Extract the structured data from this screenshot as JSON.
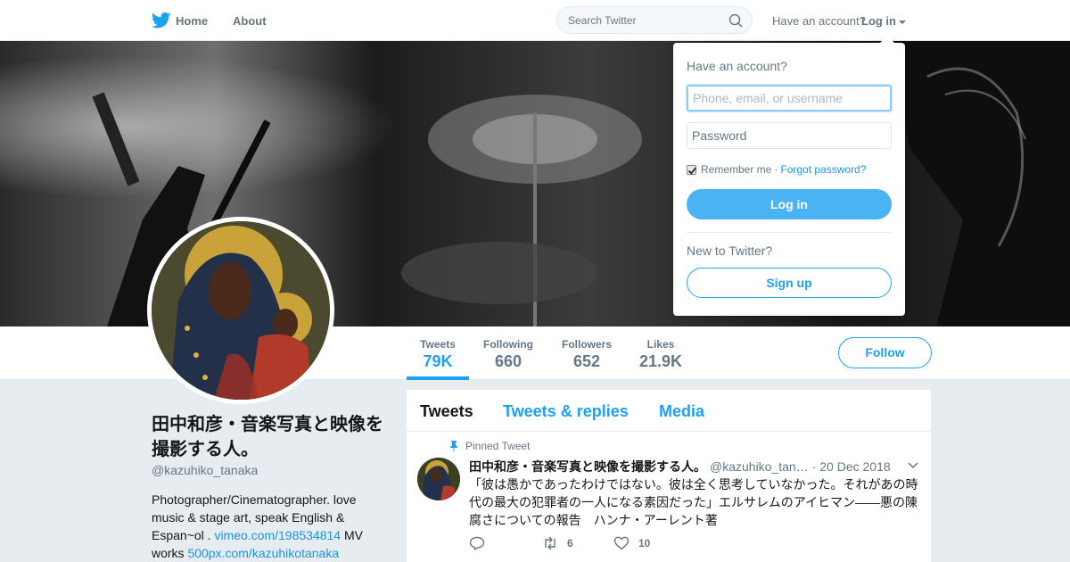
{
  "nav": {
    "home_label": "Home",
    "about_label": "About",
    "search_placeholder": "Search Twitter",
    "account_prompt": "Have an account?",
    "login_label": "Log in",
    "logo_icon": "twitter-bird-icon",
    "accent_color": "#1da1f2"
  },
  "profile": {
    "name": "田中和彦・音楽写真と映像を撮影する人。",
    "handle": "@kazuhiko_tanaka",
    "bio_text_1": "Photographer/Cinematographer. love music & stage art, speak English & Espan~ol . ",
    "bio_link_1": "vimeo.com/198534814",
    "bio_text_2": " MV works ",
    "bio_link_2": "500px.com/kazuhikotanaka",
    "follow_label": "Follow"
  },
  "stats": [
    {
      "label": "Tweets",
      "value": "79K"
    },
    {
      "label": "Following",
      "value": "660"
    },
    {
      "label": "Followers",
      "value": "652"
    },
    {
      "label": "Likes",
      "value": "21.9K"
    }
  ],
  "timeline": {
    "tabs": [
      "Tweets",
      "Tweets & replies",
      "Media"
    ],
    "pinned_label": "Pinned Tweet",
    "tweet": {
      "author": "田中和彦・音楽写真と映像を撮影する人。",
      "handle": "@kazuhiko_tan…",
      "date": "· 20 Dec 2018",
      "text": "「彼は愚かであったわけではない。彼は全く思考していなかった。それがあの時代の最大の犯罪者の一人になる素因だった」エルサレムのアイヒマン——悪の陳腐さについての報告　ハンナ・アーレント著",
      "reply_count": "",
      "retweet_count": "6",
      "like_count": "10"
    }
  },
  "login_panel": {
    "heading": "Have an account?",
    "username_placeholder": "Phone, email, or username",
    "password_placeholder": "Password",
    "remember_label": "Remember me",
    "separator": "·",
    "forgot_label": "Forgot password?",
    "login_button": "Log in",
    "new_prompt": "New to Twitter?",
    "signup_button": "Sign up"
  }
}
